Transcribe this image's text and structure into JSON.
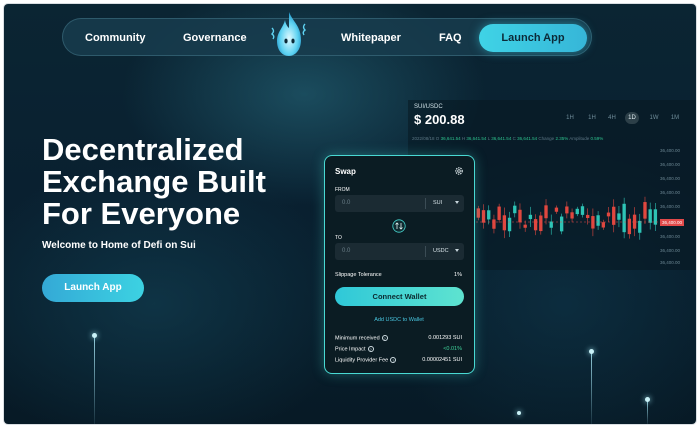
{
  "nav": {
    "links": [
      "Community",
      "Governance",
      "Whitepaper",
      "FAQ"
    ],
    "cta_label": "Launch App"
  },
  "hero": {
    "title_lines": [
      "Decentralized",
      "Exchange Built",
      "For Everyone"
    ],
    "subtitle": "Welcome to Home of Defi on Sui",
    "cta_label": "Launch App"
  },
  "chart": {
    "pair": "SUI/USDC",
    "price": "$ 200.88",
    "timeframes": [
      "1H",
      "1H",
      "4H",
      "1D",
      "1W",
      "1M"
    ],
    "active_timeframe": "1D",
    "ohlc": [
      "2022/08/18",
      "O",
      "36,641.54",
      "H",
      "36,641.54",
      "L",
      "36,641.54",
      "C",
      "36,641.54",
      "Change",
      "2.35%",
      "Amplitude",
      "0.59%"
    ],
    "y_ticks": [
      "36,400.00",
      "36,400.00",
      "36,400.00",
      "36,400.00",
      "36,400.00",
      "36,400.00",
      "36,400.00",
      "36,400.00"
    ],
    "y_badge": "36,400.00",
    "colors": {
      "up": "#2ec4b6",
      "down": "#e0473f"
    }
  },
  "swap": {
    "title": "Swap",
    "from_label": "FROM",
    "from_placeholder": "0.0",
    "from_token": "SUI",
    "to_label": "TO",
    "to_placeholder": "0.0",
    "to_token": "USDC",
    "slippage_label": "Slippage Tolerance",
    "slippage_value": "1%",
    "connect_label": "Connect Wallet",
    "add_token_link": "Add USDC to Wallet",
    "details": [
      {
        "label": "Minimum received",
        "value": "0.001293 SUI"
      },
      {
        "label": "Price Impact",
        "value": "<0.01%"
      },
      {
        "label": "Liquidity Provider Fee",
        "value": "0.00002451 SUI"
      }
    ]
  },
  "icons": [
    "settings-gear-icon",
    "swap-arrows-icon",
    "chevron-down-icon",
    "help-circle-icon",
    "flame-logo-icon"
  ]
}
